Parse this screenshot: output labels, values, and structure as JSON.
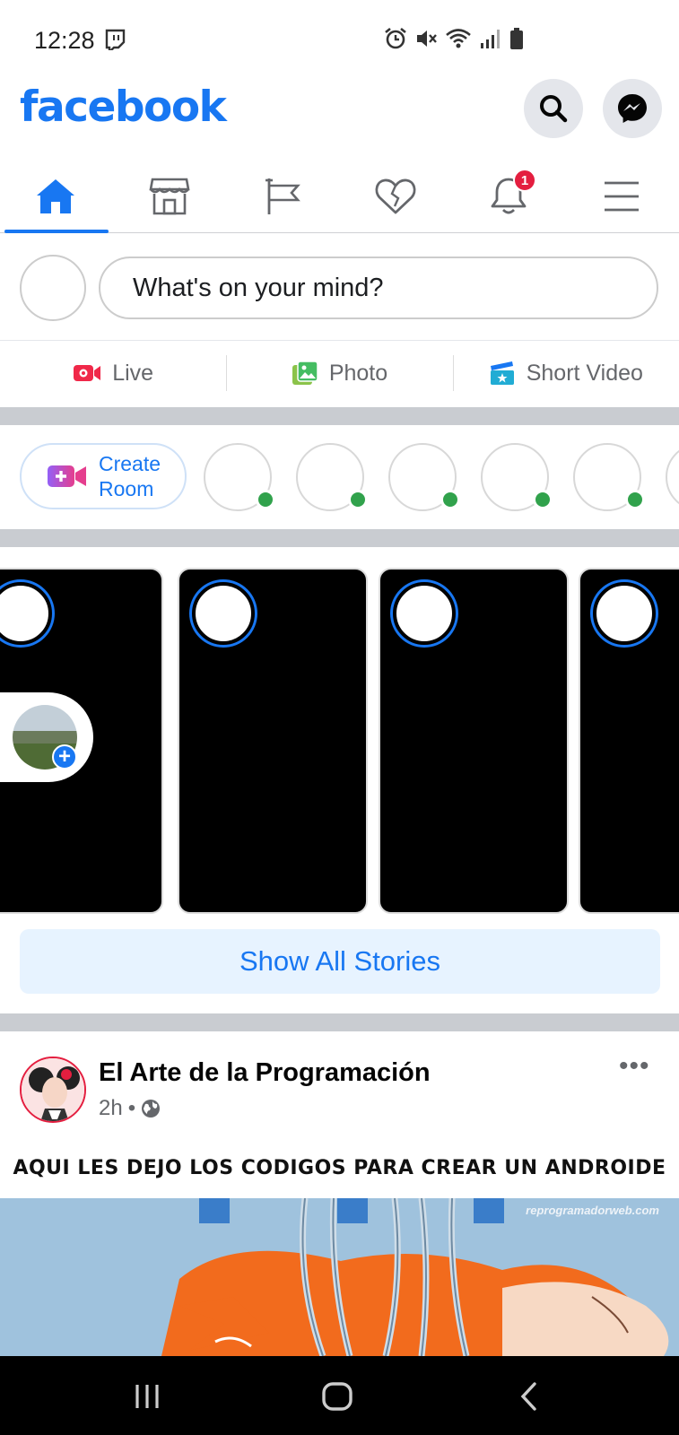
{
  "status_bar": {
    "time": "12:28",
    "icons": [
      "alarm-icon",
      "mute-icon",
      "wifi-icon",
      "signal-icon",
      "battery-icon"
    ]
  },
  "header": {
    "logo": "facebook",
    "brand_color": "#1877f2",
    "buttons": [
      "search-icon",
      "messenger-icon"
    ]
  },
  "tabs": {
    "items": [
      "home-icon",
      "marketplace-icon",
      "pages-icon",
      "dating-icon",
      "notifications-icon",
      "menu-icon"
    ],
    "active": "home-icon",
    "notification_count": "1"
  },
  "composer": {
    "placeholder": "What's on your mind?"
  },
  "actions": {
    "live": "Live",
    "photo": "Photo",
    "short_video": "Short Video"
  },
  "rooms": {
    "create_label": "Create\nRoom",
    "online_status_color": "#31a24c"
  },
  "stories": {
    "show_all": "Show All Stories"
  },
  "post": {
    "author": "El Arte de la Programación",
    "time": "2h",
    "separator": "•",
    "more": "•••",
    "caption": "AQUI LES DEJO LOS CODIGOS PARA CREAR UN ANDROIDE",
    "watermark": "reprogramadorweb.com"
  },
  "navbar": {
    "buttons": [
      "recents-icon",
      "home-circle-icon",
      "back-icon"
    ]
  }
}
